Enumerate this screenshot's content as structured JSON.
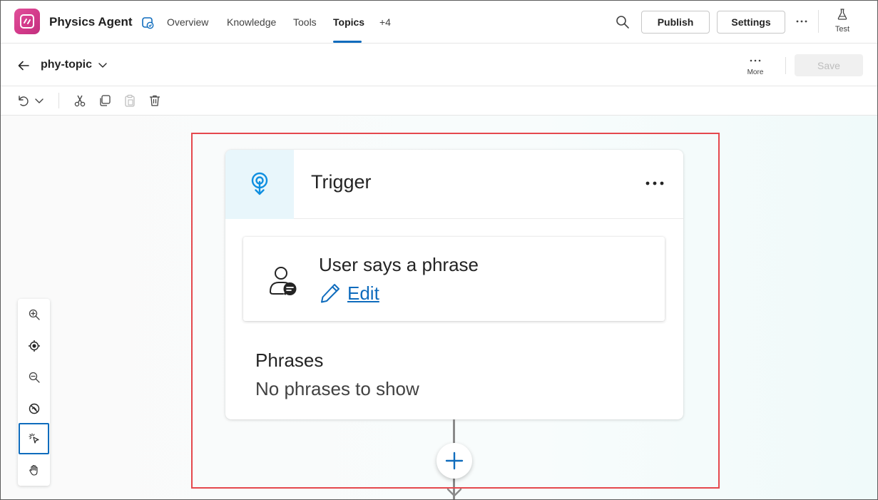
{
  "app": {
    "name": "Physics Agent",
    "accent_color": "#0f6cbd",
    "logo_color": "#d33a8a"
  },
  "nav": {
    "tabs": [
      {
        "label": "Overview",
        "active": false
      },
      {
        "label": "Knowledge",
        "active": false
      },
      {
        "label": "Tools",
        "active": false
      },
      {
        "label": "Topics",
        "active": true
      },
      {
        "label": "+4",
        "active": false
      }
    ]
  },
  "header_actions": {
    "publish_label": "Publish",
    "settings_label": "Settings",
    "test_label": "Test"
  },
  "topic": {
    "name": "phy-topic",
    "more_label": "More",
    "save_label": "Save",
    "save_enabled": false
  },
  "toolbar": {
    "icons": [
      "undo-icon",
      "chevron-down-icon",
      "cut-icon",
      "copy-icon",
      "paste-icon",
      "delete-icon"
    ]
  },
  "canvas": {
    "trigger": {
      "title": "Trigger",
      "icon": "trigger-touch-icon",
      "condition_title": "User says a phrase",
      "edit_label": "Edit",
      "phrases_heading": "Phrases",
      "phrases_empty": "No phrases to show"
    },
    "zoom_controls": [
      "zoom-in-icon",
      "recenter-icon",
      "zoom-out-icon",
      "minimap-off-icon",
      "select-mode-icon",
      "pan-mode-icon"
    ],
    "highlight_color": "#e5484d"
  }
}
